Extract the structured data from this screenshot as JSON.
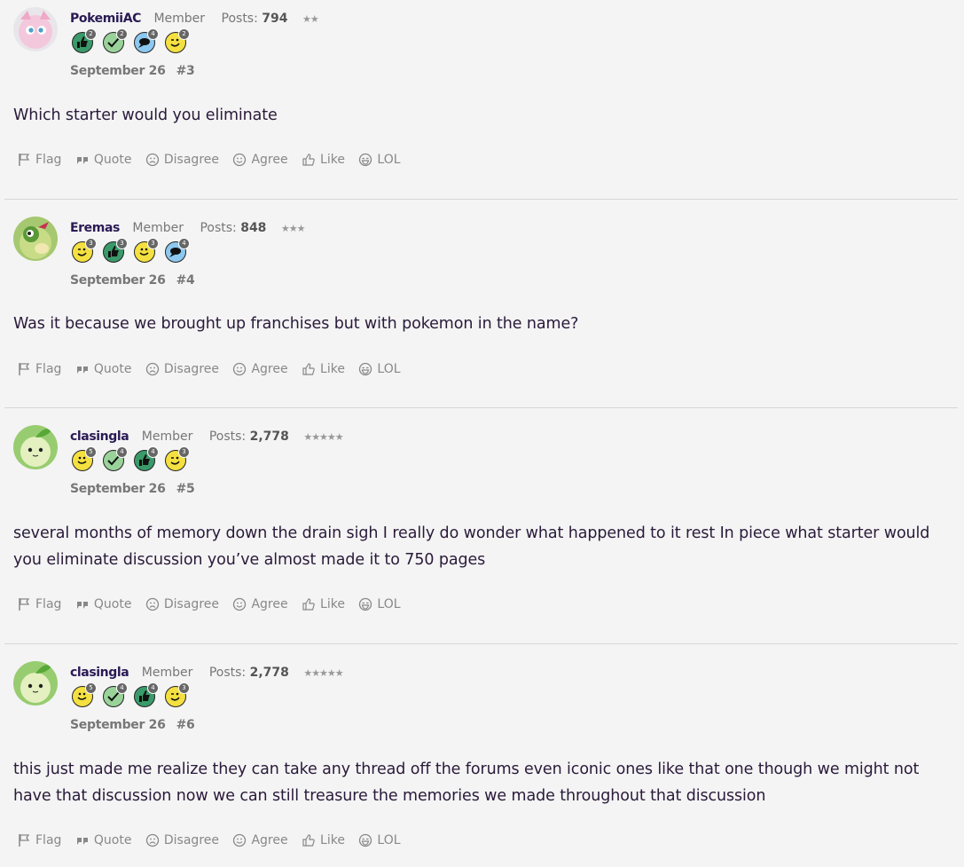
{
  "posts": [
    {
      "username": "PokemiiAC",
      "role": "Member",
      "posts_label": "Posts:",
      "post_count": "794",
      "stars": "★★",
      "date": "September 26",
      "number": "#3",
      "body": "Which starter would you eliminate",
      "badges": [
        {
          "icon": "thumbs-up-badge-icon",
          "count": "2"
        },
        {
          "icon": "check-badge-icon",
          "count": "2"
        },
        {
          "icon": "speech-badge-icon",
          "count": "4"
        },
        {
          "icon": "wink-badge-icon",
          "count": "2"
        }
      ]
    },
    {
      "username": "Eremas",
      "role": "Member",
      "posts_label": "Posts:",
      "post_count": "848",
      "stars": "★★★",
      "date": "September 26",
      "number": "#4",
      "body": "Was it because we brought up franchises but with pokemon in the name?",
      "badges": [
        {
          "icon": "wink-badge-icon",
          "count": "3"
        },
        {
          "icon": "thumbs-up-badge-icon",
          "count": "3"
        },
        {
          "icon": "smile-badge-icon",
          "count": "3"
        },
        {
          "icon": "speech-badge-icon",
          "count": "4"
        }
      ]
    },
    {
      "username": "clasingla",
      "role": "Member",
      "posts_label": "Posts:",
      "post_count": "2,778",
      "stars": "★★★★★",
      "date": "September 26",
      "number": "#5",
      "body": "several months of memory down the drain sigh I really do wonder what happened to it rest In piece what starter would you eliminate discussion you’ve almost made it to 750 pages",
      "badges": [
        {
          "icon": "smile-badge-icon",
          "count": "5"
        },
        {
          "icon": "check-badge-icon",
          "count": "4"
        },
        {
          "icon": "thumbs-up-badge-icon",
          "count": "4"
        },
        {
          "icon": "wink-badge-icon",
          "count": "3"
        }
      ]
    },
    {
      "username": "clasingla",
      "role": "Member",
      "posts_label": "Posts:",
      "post_count": "2,778",
      "stars": "★★★★★",
      "date": "September 26",
      "number": "#6",
      "body": "this just made me realize they can take any thread off the forums even iconic ones like that one though we might not have that discussion now we can still treasure the memories we made throughout that discussion",
      "badges": [
        {
          "icon": "smile-badge-icon",
          "count": "5"
        },
        {
          "icon": "check-badge-icon",
          "count": "4"
        },
        {
          "icon": "thumbs-up-badge-icon",
          "count": "4"
        },
        {
          "icon": "wink-badge-icon",
          "count": "3"
        }
      ]
    }
  ],
  "actions": {
    "flag": "Flag",
    "quote": "Quote",
    "disagree": "Disagree",
    "agree": "Agree",
    "like": "Like",
    "lol": "LOL"
  },
  "colors": {
    "background": "#f4f4f4",
    "username": "#2a1a55",
    "body_text": "#2a1a3a",
    "muted": "#777777"
  }
}
